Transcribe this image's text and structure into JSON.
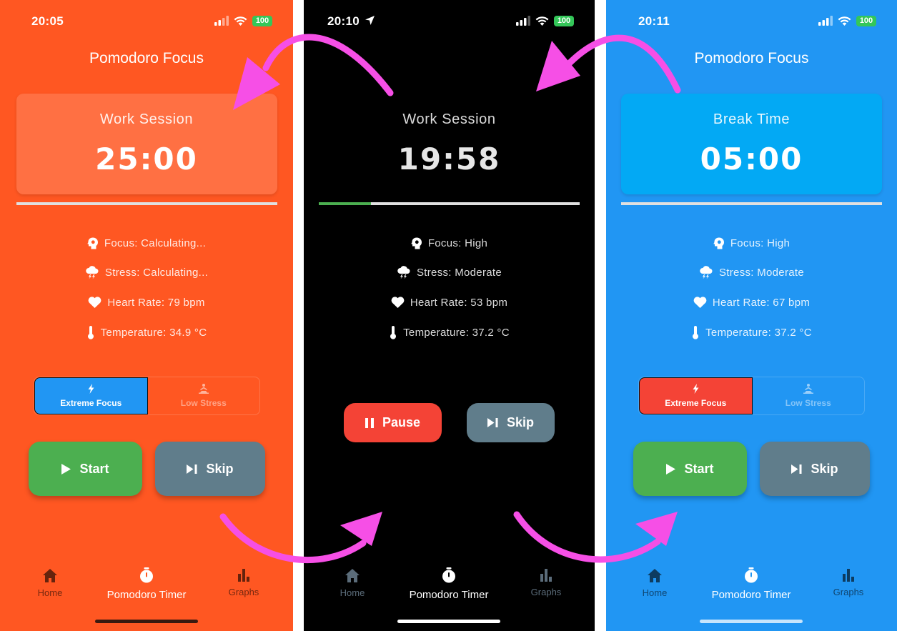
{
  "screens": [
    {
      "id": "orange",
      "status_time": "20:05",
      "battery": "100",
      "app_title": "Pomodoro Focus",
      "session_label": "Work Session",
      "timer": "25:00",
      "progress_fraction": 0,
      "metrics": {
        "focus": "Focus: Calculating...",
        "stress": "Stress: Calculating...",
        "heart_rate": "Heart Rate: 79 bpm",
        "temperature": "Temperature: 34.9 °C"
      },
      "mode_toggle": {
        "extreme_focus": "Extreme Focus",
        "low_stress": "Low Stress",
        "selected": "extreme_focus"
      },
      "buttons": {
        "start": "Start",
        "skip": "Skip"
      },
      "nav": {
        "home": "Home",
        "timer": "Pomodoro Timer",
        "graphs": "Graphs",
        "active": "timer"
      },
      "colors": {
        "background": "#ff5722",
        "card": "#ff7043",
        "selected_toggle": "#2196f3"
      }
    },
    {
      "id": "black",
      "status_time": "20:10",
      "battery": "100",
      "session_label": "Work Session",
      "timer": "19:58",
      "progress_fraction": 0.2,
      "metrics": {
        "focus": "Focus: High",
        "stress": "Stress: Moderate",
        "heart_rate": "Heart Rate: 53 bpm",
        "temperature": "Temperature: 37.2 °C"
      },
      "buttons": {
        "pause": "Pause",
        "skip": "Skip"
      },
      "nav": {
        "home": "Home",
        "timer": "Pomodoro Timer",
        "graphs": "Graphs",
        "active": "timer"
      },
      "colors": {
        "background": "#000000",
        "progress": "#4caf50",
        "pause": "#f44336"
      }
    },
    {
      "id": "blue",
      "status_time": "20:11",
      "battery": "100",
      "app_title": "Pomodoro Focus",
      "session_label": "Break Time",
      "timer": "05:00",
      "progress_fraction": 0,
      "metrics": {
        "focus": "Focus: High",
        "stress": "Stress: Moderate",
        "heart_rate": "Heart Rate: 67 bpm",
        "temperature": "Temperature: 37.2 °C"
      },
      "mode_toggle": {
        "extreme_focus": "Extreme Focus",
        "low_stress": "Low Stress",
        "selected": "extreme_focus"
      },
      "buttons": {
        "start": "Start",
        "skip": "Skip"
      },
      "nav": {
        "home": "Home",
        "timer": "Pomodoro Timer",
        "graphs": "Graphs",
        "active": "timer"
      },
      "colors": {
        "background": "#2196f3",
        "card": "#03a9f4",
        "selected_toggle": "#f44336"
      }
    }
  ],
  "annotation_color": "#f64fe6"
}
